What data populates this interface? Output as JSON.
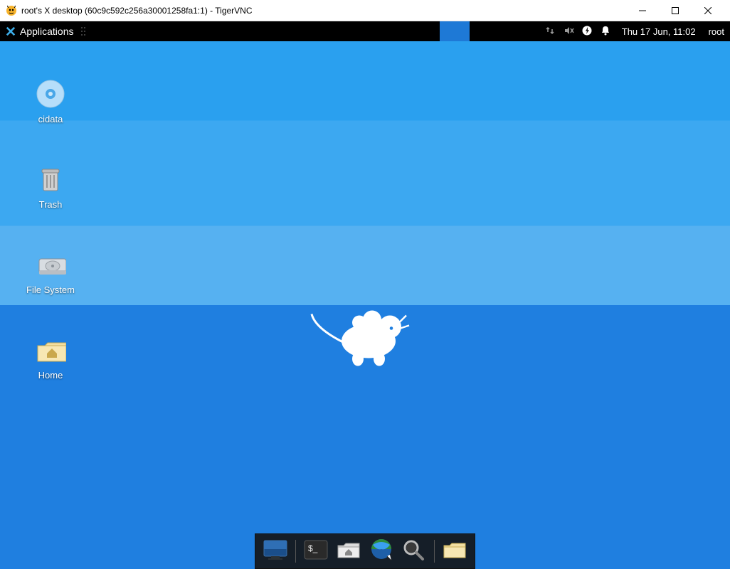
{
  "window": {
    "title": "root's X desktop (60c9c592c256a30001258fa1:1) - TigerVNC"
  },
  "panel": {
    "applications_label": "Applications",
    "clock": "Thu 17 Jun, 11:02",
    "username": "root"
  },
  "desktop_icons": [
    {
      "id": "cidata",
      "label": "cidata",
      "kind": "disc"
    },
    {
      "id": "trash",
      "label": "Trash",
      "kind": "trash"
    },
    {
      "id": "filesystem",
      "label": "File System",
      "kind": "drive"
    },
    {
      "id": "home",
      "label": "Home",
      "kind": "home"
    }
  ],
  "dock": [
    {
      "id": "show-desktop",
      "label": "Show Desktop"
    },
    {
      "id": "terminal",
      "label": "Terminal"
    },
    {
      "id": "file-manager",
      "label": "File Manager"
    },
    {
      "id": "web-browser",
      "label": "Web Browser"
    },
    {
      "id": "app-finder",
      "label": "Application Finder"
    },
    {
      "id": "folder",
      "label": "Folder"
    }
  ]
}
